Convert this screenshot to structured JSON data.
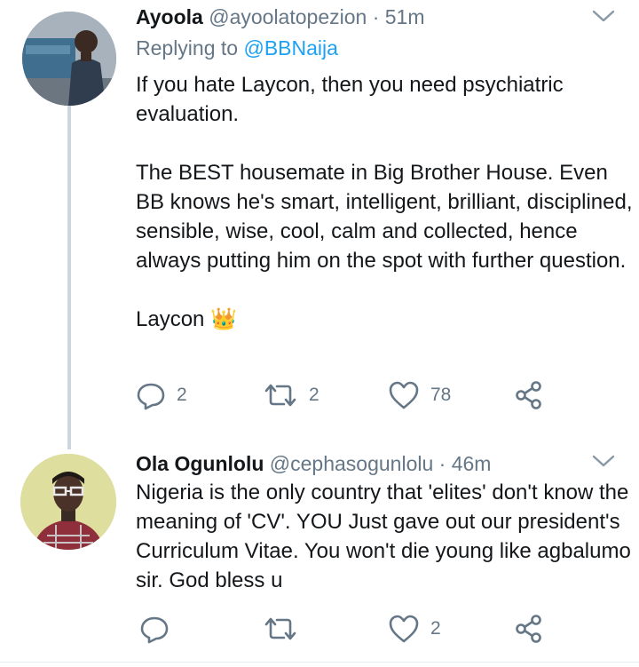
{
  "tweets": [
    {
      "name": "Ayoola",
      "handle": "@ayoolatopezion",
      "time": "51m",
      "replying_prefix": "Replying to ",
      "replying_to": "@BBNaija",
      "text": "If you hate Laycon, then you need psychiatric evaluation.\n\nThe BEST housemate in Big Brother House. Even BB knows he's smart, intelligent, brilliant, disciplined, sensible, wise, cool, calm and collected, hence always putting him on the spot with further question.\n\nLaycon 👑",
      "reply_count": "2",
      "retweet_count": "2",
      "like_count": "78"
    },
    {
      "name": "Ola Ogunlolu",
      "handle": "@cephasogunlolu",
      "time": "46m",
      "text": "Nigeria is the only country that 'elites' don't know the meaning of 'CV'. YOU Just gave out our president's Curriculum Vitae. You won't die young like agbalumo sir. God bless u",
      "reply_count": "",
      "retweet_count": "",
      "like_count": "2"
    }
  ],
  "separator": "·",
  "colors": {
    "text": "#14171a",
    "muted": "#657786",
    "link": "#1da1f2",
    "thread_line": "#ccd6dd"
  },
  "icons": [
    "reply-icon",
    "retweet-icon",
    "like-icon",
    "share-icon",
    "chevron-down-icon",
    "crown-emoji"
  ]
}
